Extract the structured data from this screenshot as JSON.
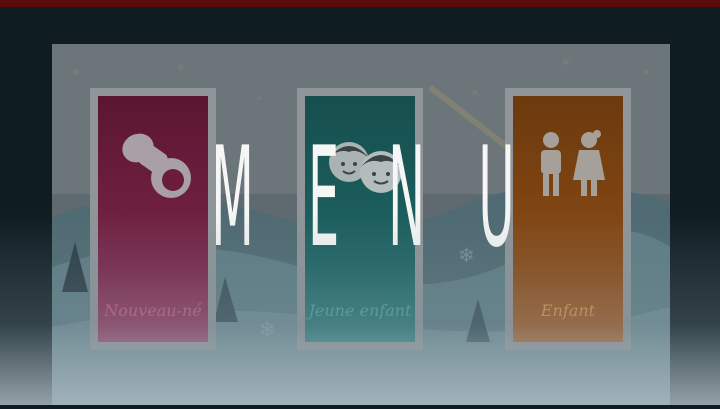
{
  "title_letters": [
    "M",
    "E",
    "N",
    "U"
  ],
  "cards": [
    {
      "label": "Nouveau-né",
      "color": "#6a1d3a",
      "label_color": "#c05a82",
      "icon": "pacifier-icon"
    },
    {
      "label": "Jeune enfant",
      "color": "#1b5d5c",
      "label_color": "#4f9f9c",
      "icon": "children-faces-icon"
    },
    {
      "label": "Enfant",
      "color": "#8a4a13",
      "label_color": "#d7924e",
      "icon": "boy-girl-icon"
    }
  ],
  "colors": {
    "top_bar": "#5a0c0c",
    "title": "#f6f6f6",
    "backdrop": "#0f1c22"
  }
}
